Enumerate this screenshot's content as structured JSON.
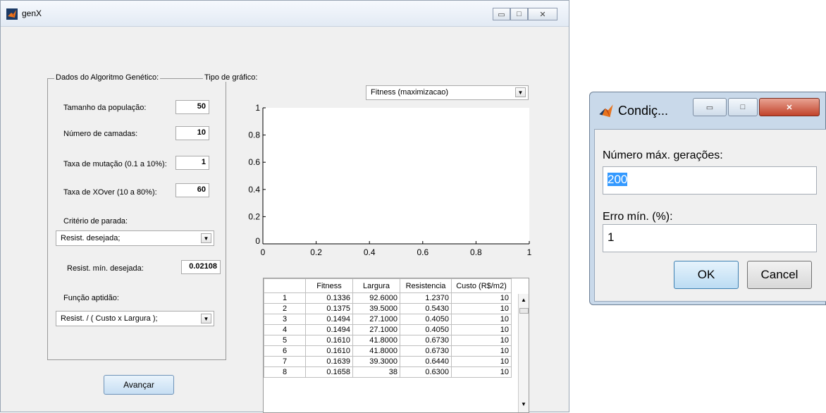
{
  "main_window": {
    "title": "genX",
    "minimize_glyph": "▭",
    "maximize_glyph": "□",
    "close_glyph": "✕"
  },
  "panel": {
    "legend": "Dados do Algoritmo Genético:",
    "fields": [
      {
        "label": "Tamanho da população:",
        "value": "50"
      },
      {
        "label": "Número de camadas:",
        "value": "10"
      },
      {
        "label": "Taxa de mutação (0.1 a 10%):",
        "value": "1"
      },
      {
        "label": "Taxa de XOver (10 a 80%):",
        "value": "60"
      }
    ],
    "stop_label": "Critério de parada:",
    "stop_value": "Resist. desejada;",
    "resist_label": "Resist. mín. desejada:",
    "resist_value": "0.02108",
    "fitness_label": "Função aptidão:",
    "fitness_value": "Resist. / ( Custo x Largura );"
  },
  "chart_type_label": "Tipo de gráfico:",
  "chart_type_value": "Fitness (maximizacao)",
  "avancar_label": "Avançar",
  "chart_data": {
    "type": "line",
    "x_ticks": [
      "0",
      "0.2",
      "0.4",
      "0.6",
      "0.8",
      "1"
    ],
    "y_ticks": [
      "0",
      "0.2",
      "0.4",
      "0.6",
      "0.8",
      "1"
    ],
    "xlim": [
      0,
      1
    ],
    "ylim": [
      0,
      1
    ],
    "series": []
  },
  "table": {
    "headers": [
      "Fitness",
      "Largura",
      "Resistencia",
      "Custo (R$/m2)"
    ],
    "rows": [
      {
        "idx": "1",
        "cells": [
          "0.1336",
          "92.6000",
          "1.2370",
          "10"
        ]
      },
      {
        "idx": "2",
        "cells": [
          "0.1375",
          "39.5000",
          "0.5430",
          "10"
        ]
      },
      {
        "idx": "3",
        "cells": [
          "0.1494",
          "27.1000",
          "0.4050",
          "10"
        ]
      },
      {
        "idx": "4",
        "cells": [
          "0.1494",
          "27.1000",
          "0.4050",
          "10"
        ]
      },
      {
        "idx": "5",
        "cells": [
          "0.1610",
          "41.8000",
          "0.6730",
          "10"
        ]
      },
      {
        "idx": "6",
        "cells": [
          "0.1610",
          "41.8000",
          "0.6730",
          "10"
        ]
      },
      {
        "idx": "7",
        "cells": [
          "0.1639",
          "39.3000",
          "0.6440",
          "10"
        ]
      },
      {
        "idx": "8",
        "cells": [
          "0.1658",
          "38",
          "0.6300",
          "10"
        ]
      }
    ]
  },
  "dialog": {
    "title": "Condiç...",
    "gen_label": "Número máx. gerações:",
    "gen_value": "200",
    "err_label": "Erro mín. (%):",
    "err_value": "1",
    "ok_label": "OK",
    "cancel_label": "Cancel"
  }
}
